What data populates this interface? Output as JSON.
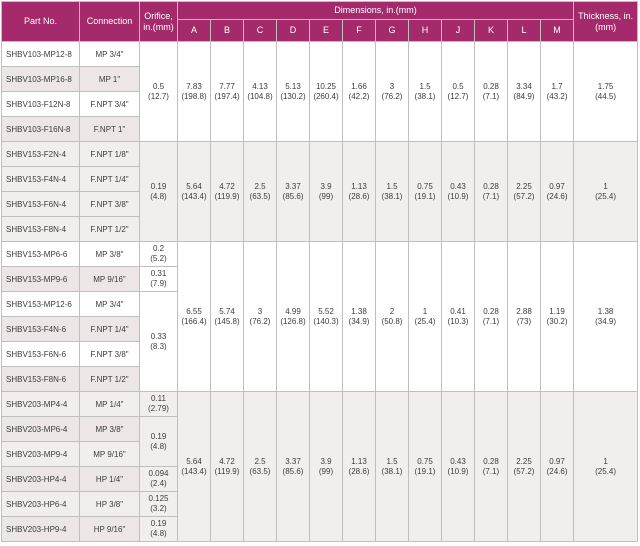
{
  "headers": {
    "part_no": "Part No.",
    "connection": "Connection",
    "orifice": "Orifice, in.(mm)",
    "dimensions": "Dimensions, in.(mm)",
    "letters": [
      "A",
      "B",
      "C",
      "D",
      "E",
      "F",
      "G",
      "H",
      "J",
      "K",
      "L",
      "M"
    ],
    "thickness": "Thickness, in.(mm)"
  },
  "groups": [
    {
      "rows": [
        {
          "part": "SHBV103-MP12-8",
          "conn": "MP 3/4\""
        },
        {
          "part": "SHBV103-MP16-8",
          "conn": "MP 1\""
        },
        {
          "part": "SHBV103-F12N-8",
          "conn": "F.NPT 3/4\""
        },
        {
          "part": "SHBV103-F16N-8",
          "conn": "F.NPT 1\""
        }
      ],
      "orifice": [
        {
          "in": "0.5",
          "mm": "(12.7)"
        }
      ],
      "dims": [
        {
          "in": "7.83",
          "mm": "(198.8)"
        },
        {
          "in": "7.77",
          "mm": "(197.4)"
        },
        {
          "in": "4.13",
          "mm": "(104.8)"
        },
        {
          "in": "5.13",
          "mm": "(130.2)"
        },
        {
          "in": "10.25",
          "mm": "(260.4)"
        },
        {
          "in": "1.66",
          "mm": "(42.2)"
        },
        {
          "in": "3",
          "mm": "(76.2)"
        },
        {
          "in": "1.5",
          "mm": "(38.1)"
        },
        {
          "in": "0.5",
          "mm": "(12.7)"
        },
        {
          "in": "0.28",
          "mm": "(7.1)"
        },
        {
          "in": "3.34",
          "mm": "(84.9)"
        },
        {
          "in": "1.7",
          "mm": "(43.2)"
        }
      ],
      "thickness": {
        "in": "1.75",
        "mm": "(44.5)"
      }
    },
    {
      "rows": [
        {
          "part": "SHBV153-F2N-4",
          "conn": "F.NPT 1/8\""
        },
        {
          "part": "SHBV153-F4N-4",
          "conn": "F.NPT 1/4\""
        },
        {
          "part": "SHBV153-F6N-4",
          "conn": "F.NPT 3/8\""
        },
        {
          "part": "SHBV153-F8N-4",
          "conn": "F.NPT 1/2\""
        }
      ],
      "orifice": [
        {
          "in": "0.19",
          "mm": "(4.8)"
        }
      ],
      "dims": [
        {
          "in": "5.64",
          "mm": "(143.4)"
        },
        {
          "in": "4.72",
          "mm": "(119.9)"
        },
        {
          "in": "2.5",
          "mm": "(63.5)"
        },
        {
          "in": "3.37",
          "mm": "(85.6)"
        },
        {
          "in": "3.9",
          "mm": "(99)"
        },
        {
          "in": "1.13",
          "mm": "(28.6)"
        },
        {
          "in": "1.5",
          "mm": "(38.1)"
        },
        {
          "in": "0.75",
          "mm": "(19.1)"
        },
        {
          "in": "0.43",
          "mm": "(10.9)"
        },
        {
          "in": "0.28",
          "mm": "(7.1)"
        },
        {
          "in": "2.25",
          "mm": "(57.2)"
        },
        {
          "in": "0.97",
          "mm": "(24.6)"
        }
      ],
      "thickness": {
        "in": "1",
        "mm": "(25.4)"
      }
    },
    {
      "rows": [
        {
          "part": "SHBV153-MP6-6",
          "conn": "MP 3/8\""
        },
        {
          "part": "SHBV153-MP9-6",
          "conn": "MP 9/16\""
        },
        {
          "part": "SHBV153-MP12-6",
          "conn": "MP 3/4\""
        },
        {
          "part": "SHBV153-F4N-6",
          "conn": "F.NPT 1/4\""
        },
        {
          "part": "SHBV153-F6N-6",
          "conn": "F.NPT 3/8\""
        },
        {
          "part": "SHBV153-F8N-6",
          "conn": "F.NPT 1/2\""
        }
      ],
      "orifice": [
        {
          "in": "0.2",
          "mm": "(5.2)"
        },
        {
          "in": "0.31",
          "mm": "(7.9)"
        },
        {
          "in": "0.33",
          "mm": "(8.3)"
        }
      ],
      "dims": [
        {
          "in": "6.55",
          "mm": "(166.4)"
        },
        {
          "in": "5.74",
          "mm": "(145.8)"
        },
        {
          "in": "3",
          "mm": "(76.2)"
        },
        {
          "in": "4.99",
          "mm": "(126.8)"
        },
        {
          "in": "5.52",
          "mm": "(140.3)"
        },
        {
          "in": "1.38",
          "mm": "(34.9)"
        },
        {
          "in": "2",
          "mm": "(50.8)"
        },
        {
          "in": "1",
          "mm": "(25.4)"
        },
        {
          "in": "0.41",
          "mm": "(10.3)"
        },
        {
          "in": "0.28",
          "mm": "(7.1)"
        },
        {
          "in": "2.88",
          "mm": "(73)"
        },
        {
          "in": "1.19",
          "mm": "(30.2)"
        }
      ],
      "thickness": {
        "in": "1.38",
        "mm": "(34.9)"
      }
    },
    {
      "rows": [
        {
          "part": "SHBV203-MP4-4",
          "conn": "MP 1/4\""
        },
        {
          "part": "SHBV203-MP6-4",
          "conn": "MP 3/8\""
        },
        {
          "part": "SHBV203-MP9-4",
          "conn": "MP 9/16\""
        },
        {
          "part": "SHBV203-HP4-4",
          "conn": "HP 1/4\""
        },
        {
          "part": "SHBV203-HP6-4",
          "conn": "HP 3/8\""
        },
        {
          "part": "SHBV203-HP9-4",
          "conn": "HP 9/16\""
        }
      ],
      "orifice": [
        {
          "in": "0.11",
          "mm": "(2.79)"
        },
        {
          "in": "0.19",
          "mm": "(4.8)"
        },
        {
          "in": "0.094",
          "mm": "(2.4)"
        },
        {
          "in": "0.125",
          "mm": "(3.2)"
        },
        {
          "in": "0.19",
          "mm": "(4.8)"
        }
      ],
      "dims": [
        {
          "in": "5.64",
          "mm": "(143.4)"
        },
        {
          "in": "4.72",
          "mm": "(119.9)"
        },
        {
          "in": "2.5",
          "mm": "(63.5)"
        },
        {
          "in": "3.37",
          "mm": "(85.6)"
        },
        {
          "in": "3.9",
          "mm": "(99)"
        },
        {
          "in": "1.13",
          "mm": "(28.6)"
        },
        {
          "in": "1.5",
          "mm": "(38.1)"
        },
        {
          "in": "0.75",
          "mm": "(19.1)"
        },
        {
          "in": "0.43",
          "mm": "(10.9)"
        },
        {
          "in": "0.28",
          "mm": "(7.1)"
        },
        {
          "in": "2.25",
          "mm": "(57.2)"
        },
        {
          "in": "0.97",
          "mm": "(24.6)"
        }
      ],
      "thickness": {
        "in": "1",
        "mm": "(25.4)"
      }
    }
  ],
  "colors": {
    "header_bg": "#a52a6b",
    "header_text": "#ffffff",
    "grid": "#bfbfbf",
    "shaded_group": "#f3eeee",
    "text": "#3c3c3c"
  }
}
